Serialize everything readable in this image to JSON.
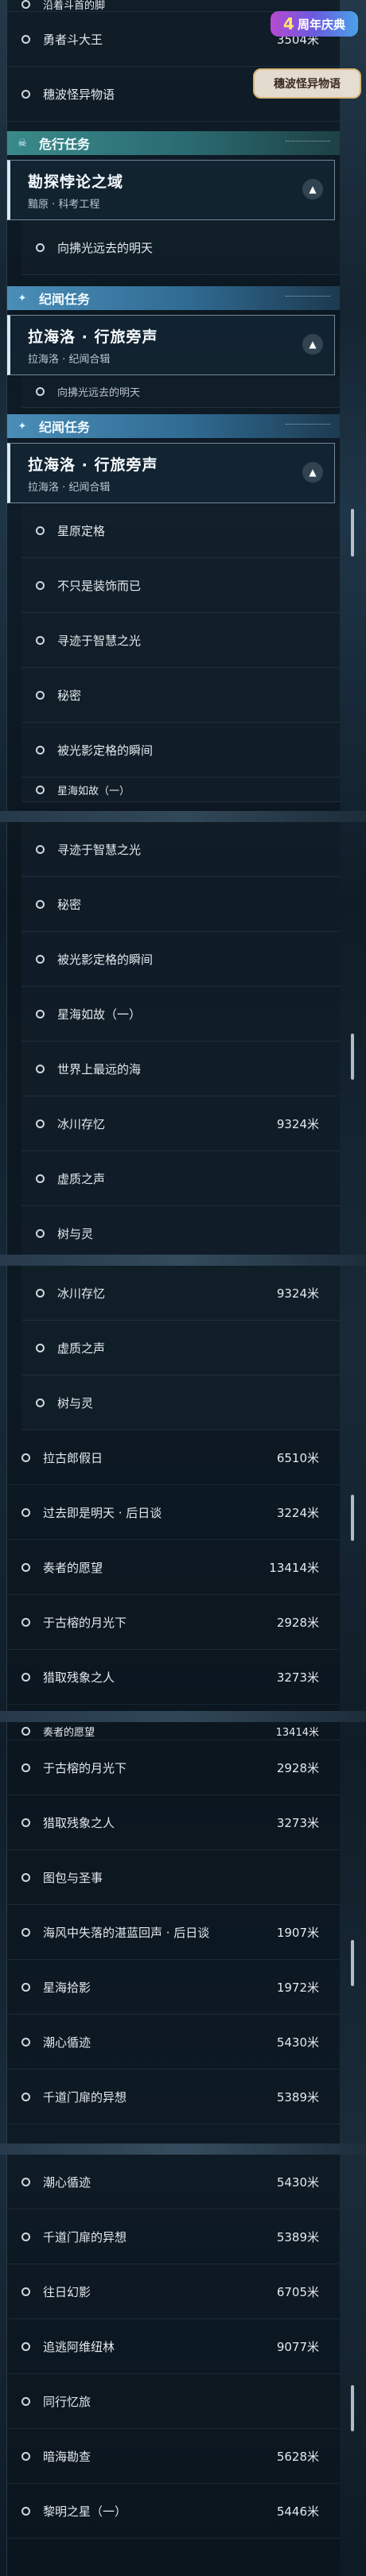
{
  "badges": {
    "anniversary": "周年庆典",
    "anniversary_num": "4",
    "story": "穗波怪异物语"
  },
  "frag1": {
    "partial_top": "沿着斗首的脚",
    "rows": [
      {
        "label": "勇者斗大王",
        "dist": "3504米"
      },
      {
        "label": "穗波怪异物语",
        "dist": ""
      }
    ],
    "sec_danger": {
      "title": "危行任务",
      "icon": "skull-icon"
    },
    "mission1": {
      "title": "勘探悖论之域",
      "subtitle": "黯原 · 科考工程"
    },
    "sub_row": {
      "label": "向拂光远去的明天"
    },
    "sec_collect": {
      "title": "纪闻任务",
      "icon": "sparkle-icon"
    },
    "mission2": {
      "title": "拉海洛 · 行旅旁声",
      "subtitle": "拉海洛 · 纪闻合辑"
    },
    "overlap_row": "向拂光远去的明天",
    "sec_collect2": {
      "title": "纪闻任务"
    },
    "mission3": {
      "title": "拉海洛 · 行旅旁声",
      "subtitle": "拉海洛 · 纪闻合辑"
    },
    "list": [
      {
        "label": "星原定格",
        "dist": ""
      },
      {
        "label": "不只是装饰而已",
        "dist": ""
      },
      {
        "label": "寻迹于智慧之光",
        "dist": ""
      },
      {
        "label": "秘密",
        "dist": ""
      },
      {
        "label": "被光影定格的瞬间",
        "dist": ""
      }
    ],
    "partial_bottom": "星海如故（一）"
  },
  "frag2": {
    "rows": [
      {
        "label": "寻迹于智慧之光",
        "dist": ""
      },
      {
        "label": "秘密",
        "dist": ""
      },
      {
        "label": "被光影定格的瞬间",
        "dist": ""
      },
      {
        "label": "星海如故（一）",
        "dist": ""
      },
      {
        "label": "世界上最远的海",
        "dist": ""
      },
      {
        "label": "冰川存忆",
        "dist": "9324米"
      },
      {
        "label": "虚质之声",
        "dist": ""
      },
      {
        "label": "树与灵",
        "dist": ""
      }
    ]
  },
  "frag3": {
    "sub_rows": [
      {
        "label": "冰川存忆",
        "dist": "9324米"
      },
      {
        "label": "虚质之声",
        "dist": ""
      },
      {
        "label": "树与灵",
        "dist": ""
      }
    ],
    "rows": [
      {
        "label": "拉古郎假日",
        "dist": "6510米"
      },
      {
        "label": "过去即是明天 · 后日谈",
        "dist": "3224米"
      },
      {
        "label": "奏者的愿望",
        "dist": "13414米"
      },
      {
        "label": "于古榕的月光下",
        "dist": "2928米"
      },
      {
        "label": "猎取残象之人",
        "dist": "3273米"
      }
    ]
  },
  "frag4": {
    "partial_top": "奏者的愿望",
    "partial_top_dist": "13414米",
    "rows": [
      {
        "label": "于古榕的月光下",
        "dist": "2928米"
      },
      {
        "label": "猎取残象之人",
        "dist": "3273米"
      },
      {
        "label": "图包与圣事",
        "dist": ""
      },
      {
        "label": "海风中失落的湛蓝回声 · 后日谈",
        "dist": "1907米"
      },
      {
        "label": "星海拾影",
        "dist": "1972米"
      },
      {
        "label": "潮心循迹",
        "dist": "5430米"
      },
      {
        "label": "千道门扉的异想",
        "dist": "5389米"
      }
    ]
  },
  "frag5": {
    "rows": [
      {
        "label": "潮心循迹",
        "dist": "5430米"
      },
      {
        "label": "千道门扉的异想",
        "dist": "5389米"
      },
      {
        "label": "往日幻影",
        "dist": "6705米"
      },
      {
        "label": "追逃阿维纽林",
        "dist": "9077米"
      },
      {
        "label": "同行忆旅",
        "dist": ""
      },
      {
        "label": "暗海勘查",
        "dist": "5628米"
      },
      {
        "label": "黎明之星（一）",
        "dist": "5446米"
      }
    ]
  }
}
